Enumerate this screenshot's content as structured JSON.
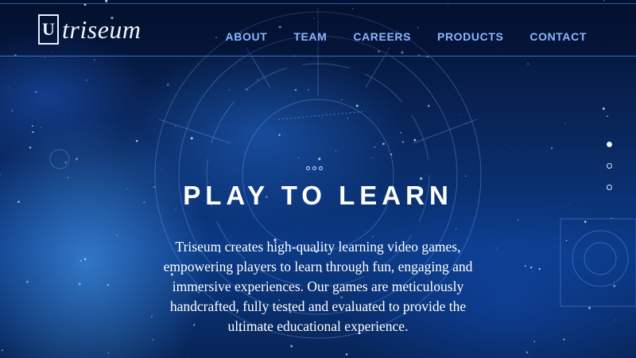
{
  "brand": {
    "logo_mark": "U",
    "name": "triseum"
  },
  "nav": {
    "items": [
      {
        "label": "ABOUT"
      },
      {
        "label": "TEAM"
      },
      {
        "label": "CAREERS"
      },
      {
        "label": "PRODUCTS"
      },
      {
        "label": "CONTACT"
      }
    ]
  },
  "hero": {
    "headline": "PLAY TO LEARN",
    "blurb": "Triseum creates high-quality learning video games, empowering players to learn through fun, engaging and immersive experiences. Our games are meticulously handcrafted, fully tested and evaluated to provide the ultimate educational experience."
  },
  "slider": {
    "slide_count": 3,
    "active_index": 0
  },
  "colors": {
    "nav_link": "#8ab6ff",
    "accent_line": "#2e6fd6",
    "text": "#ffffff"
  }
}
